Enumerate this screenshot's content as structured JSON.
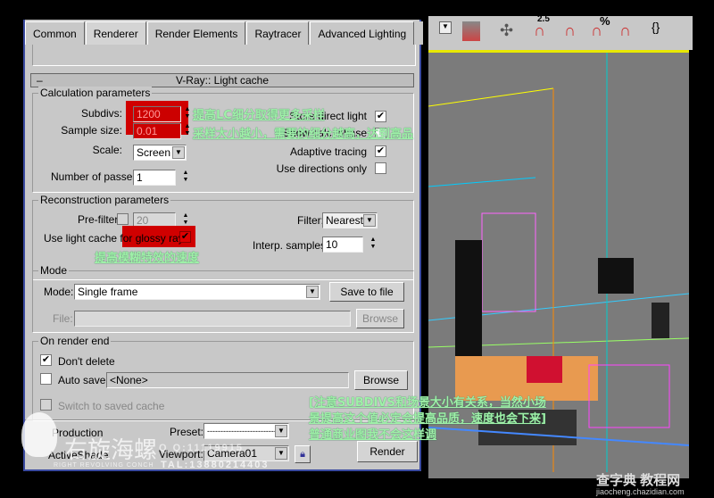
{
  "tabs": [
    "Common",
    "Renderer",
    "Render Elements",
    "Raytracer",
    "Advanced Lighting"
  ],
  "active_tab": "Renderer",
  "rollout_title": "V-Ray:: Light cache",
  "calc": {
    "title": "Calculation parameters",
    "subdivs_label": "Subdivs:",
    "subdivs": "1200",
    "sample_size_label": "Sample size:",
    "sample_size": "0.01",
    "scale_label": "Scale:",
    "scale": "Screen",
    "passes_label": "Number of passes:",
    "passes": "1",
    "store_direct_light": "Store direct light",
    "store_direct_light_checked": true,
    "show_calc_phase": "Show calc. phase",
    "adaptive_tracing": "Adaptive tracing",
    "adaptive_tracing_checked": true,
    "use_directions_only": "Use directions only",
    "use_directions_only_checked": false
  },
  "recon": {
    "title": "Reconstruction parameters",
    "prefilter_label": "Pre-filter:",
    "prefilter_checked": false,
    "prefilter_value": "20",
    "glossy_label": "Use light cache for glossy rays",
    "glossy_checked": true,
    "filter_label": "Filter:",
    "filter": "Nearest",
    "interp_label": "Interp. samples:",
    "interp": "10"
  },
  "mode": {
    "title": "Mode",
    "mode_label": "Mode:",
    "mode": "Single frame",
    "save_btn": "Save to file",
    "file_label": "File:",
    "file": "",
    "browse": "Browse"
  },
  "render_end": {
    "title": "On render end",
    "dont_delete": "Don't delete",
    "dont_delete_checked": true,
    "auto_save": "Auto save:",
    "auto_save_checked": false,
    "auto_save_value": "<None>",
    "browse": "Browse",
    "switch": "Switch to saved cache"
  },
  "bottom": {
    "production": "Production",
    "activeshade": "ActiveShade",
    "preset_label": "Preset:",
    "preset": "----------------------------",
    "viewport_label": "Viewport:",
    "viewport": "Camera01",
    "render": "Render"
  },
  "annotations": {
    "subdivs": "提高LC细分取得更多采样",
    "sample": "采样大小越小，需要的细分越高，达到高品",
    "glossy": "提高模糊特效的速度",
    "note1": "[注意SUBDIVS和场景大小有关系，当然小场",
    "note2": "景提高这个值必定会提高品质，速度也会下来]",
    "note3": "普通商业图我不会这样调"
  },
  "watermark": {
    "logo": "右旋海螺",
    "sub": "RIGHT REVOLVING CONCH",
    "qq": "Q Q:11119915",
    "tel": "TAL:13880214403",
    "site": "查字典 教程网",
    "url": "jiaocheng.chazidian.com"
  },
  "toolbar": {
    "snap_angle": "2.5",
    "percent": "%"
  },
  "colors": {
    "annotation": "#9ff0a8",
    "highlight": "#d00000",
    "viewport_border": "#e8e800"
  }
}
